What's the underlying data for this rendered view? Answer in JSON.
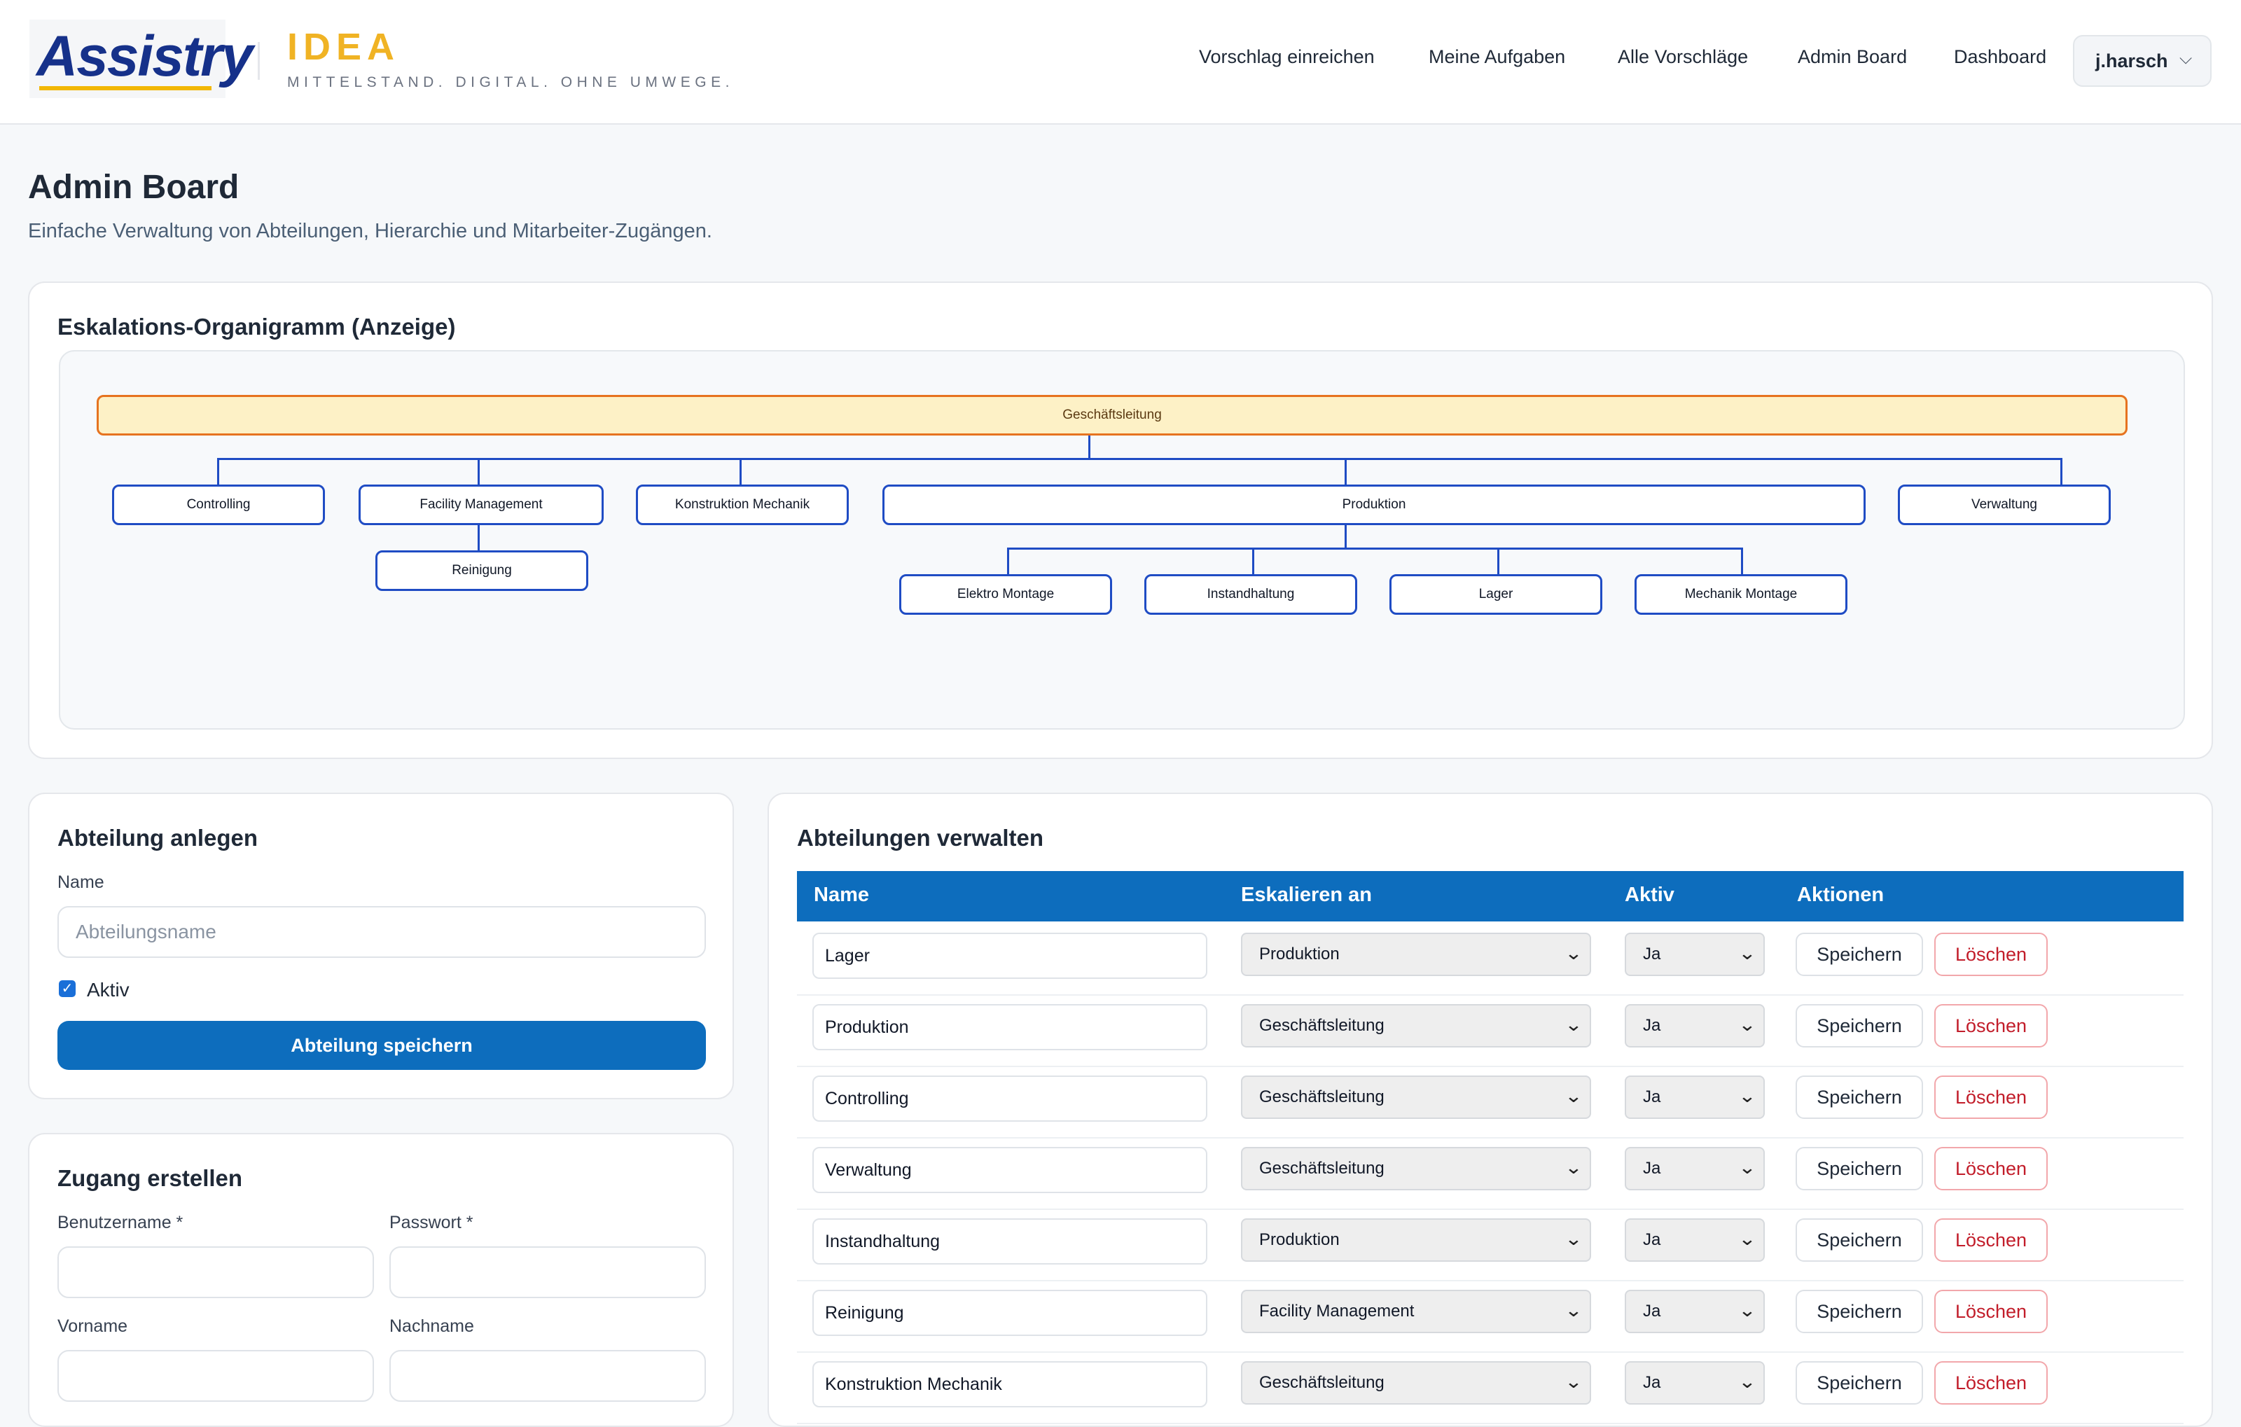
{
  "header": {
    "logo_text": "Assistry",
    "brand_title": "IDEA",
    "brand_subtitle": "MITTELSTAND. DIGITAL. OHNE UMWEGE.",
    "nav": [
      {
        "label": "Vorschlag einreichen"
      },
      {
        "label": "Meine Aufgaben"
      },
      {
        "label": "Alle Vorschläge"
      },
      {
        "label": "Admin Board"
      },
      {
        "label": "Dashboard"
      }
    ],
    "user": "j.harsch"
  },
  "page": {
    "title": "Admin Board",
    "subtitle": "Einfache Verwaltung von Abteilungen, Hierarchie und Mitarbeiter-Zugängen."
  },
  "org_chart": {
    "title": "Eskalations-Organigramm (Anzeige)",
    "root": "Geschäftsleitung",
    "level1": [
      "Controlling",
      "Facility Management",
      "Konstruktion Mechanik",
      "Produktion",
      "Verwaltung"
    ],
    "facility_children": [
      "Reinigung"
    ],
    "produktion_children": [
      "Elektro Montage",
      "Instandhaltung",
      "Lager",
      "Mechanik Montage"
    ]
  },
  "dept_form": {
    "title": "Abteilung anlegen",
    "name_label": "Name",
    "name_placeholder": "Abteilungsname",
    "active_label": "Aktiv",
    "active_checked": true,
    "submit_label": "Abteilung speichern"
  },
  "access_form": {
    "title": "Zugang erstellen",
    "username_label": "Benutzername *",
    "password_label": "Passwort *",
    "firstname_label": "Vorname",
    "lastname_label": "Nachname"
  },
  "dept_table": {
    "title": "Abteilungen verwalten",
    "columns": [
      "Name",
      "Eskalieren an",
      "Aktiv",
      "Aktionen"
    ],
    "save_label": "Speichern",
    "delete_label": "Löschen",
    "rows": [
      {
        "name": "Lager",
        "escalate_to": "Produktion",
        "active": "Ja"
      },
      {
        "name": "Produktion",
        "escalate_to": "Geschäftsleitung",
        "active": "Ja"
      },
      {
        "name": "Controlling",
        "escalate_to": "Geschäftsleitung",
        "active": "Ja"
      },
      {
        "name": "Verwaltung",
        "escalate_to": "Geschäftsleitung",
        "active": "Ja"
      },
      {
        "name": "Instandhaltung",
        "escalate_to": "Produktion",
        "active": "Ja"
      },
      {
        "name": "Reinigung",
        "escalate_to": "Facility Management",
        "active": "Ja"
      },
      {
        "name": "Konstruktion Mechanik",
        "escalate_to": "Geschäftsleitung",
        "active": "Ja"
      }
    ]
  },
  "colors": {
    "primary": "#0d6dbd",
    "brand_yellow": "#f0b324",
    "logo_blue": "#16318a",
    "danger": "#c21d2a",
    "org_node_border": "#1f4cc4",
    "org_root_fill": "#fdf1c6",
    "org_root_border": "#e6731f"
  }
}
